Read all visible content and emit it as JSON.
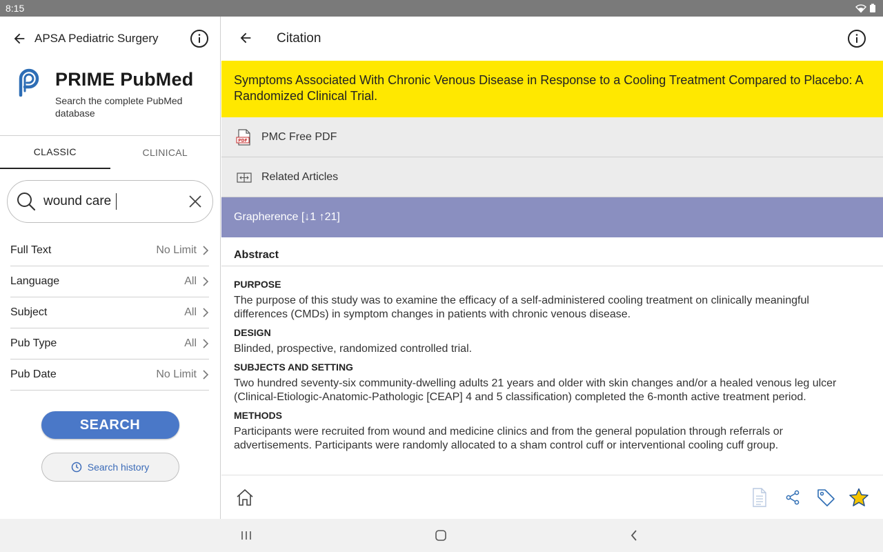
{
  "status_bar": {
    "time": "8:15"
  },
  "left_pane": {
    "header": {
      "title": "APSA Pediatric Surgery"
    },
    "brand": {
      "name": "PRIME PubMed",
      "tagline": "Search the complete PubMed database"
    },
    "tabs": [
      {
        "label": "CLASSIC",
        "active": true
      },
      {
        "label": "CLINICAL",
        "active": false
      }
    ],
    "search": {
      "value": "wound care",
      "placeholder": ""
    },
    "filters": [
      {
        "label": "Full Text",
        "value": "No Limit"
      },
      {
        "label": "Language",
        "value": "All"
      },
      {
        "label": "Subject",
        "value": "All"
      },
      {
        "label": "Pub Type",
        "value": "All"
      },
      {
        "label": "Pub Date",
        "value": "No Limit"
      }
    ],
    "search_button": "SEARCH",
    "history_button": "Search history"
  },
  "right_pane": {
    "header": {
      "title": "Citation"
    },
    "citation_title": "Symptoms Associated With Chronic Venous Disease in Response to a Cooling Treatment Compared to Placebo: A Randomized Clinical Trial.",
    "links": [
      {
        "label": "PMC Free PDF",
        "icon": "pdf-icon"
      },
      {
        "label": "Related Articles",
        "icon": "related-articles-icon"
      }
    ],
    "grapherence": "Grapherence [↓1 ↑21]",
    "abstract": {
      "heading": "Abstract",
      "sections": [
        {
          "title": "PURPOSE",
          "text": "The purpose of this study was to examine the efficacy of a self-administered cooling treatment on clinically meaningful differences (CMDs) in symptom changes in patients with chronic venous disease."
        },
        {
          "title": "DESIGN",
          "text": "Blinded, prospective, randomized controlled trial."
        },
        {
          "title": "SUBJECTS AND SETTING",
          "text": "Two hundred seventy-six community-dwelling adults 21 years and older with skin changes and/or a healed venous leg ulcer (Clinical-Etiologic-Anatomic-Pathologic [CEAP] 4 and 5 classification) completed the 6-month active treatment period."
        },
        {
          "title": "METHODS",
          "text": "Participants were recruited from wound and medicine clinics and from the general population through referrals or advertisements. Participants were randomly allocated to a sham control cuff or interventional cooling cuff group."
        }
      ]
    }
  },
  "colors": {
    "citation_highlight": "#ffe800",
    "grapherence_bg": "#8a8fc0",
    "search_button": "#4a78c8",
    "star": "#f5c400"
  }
}
